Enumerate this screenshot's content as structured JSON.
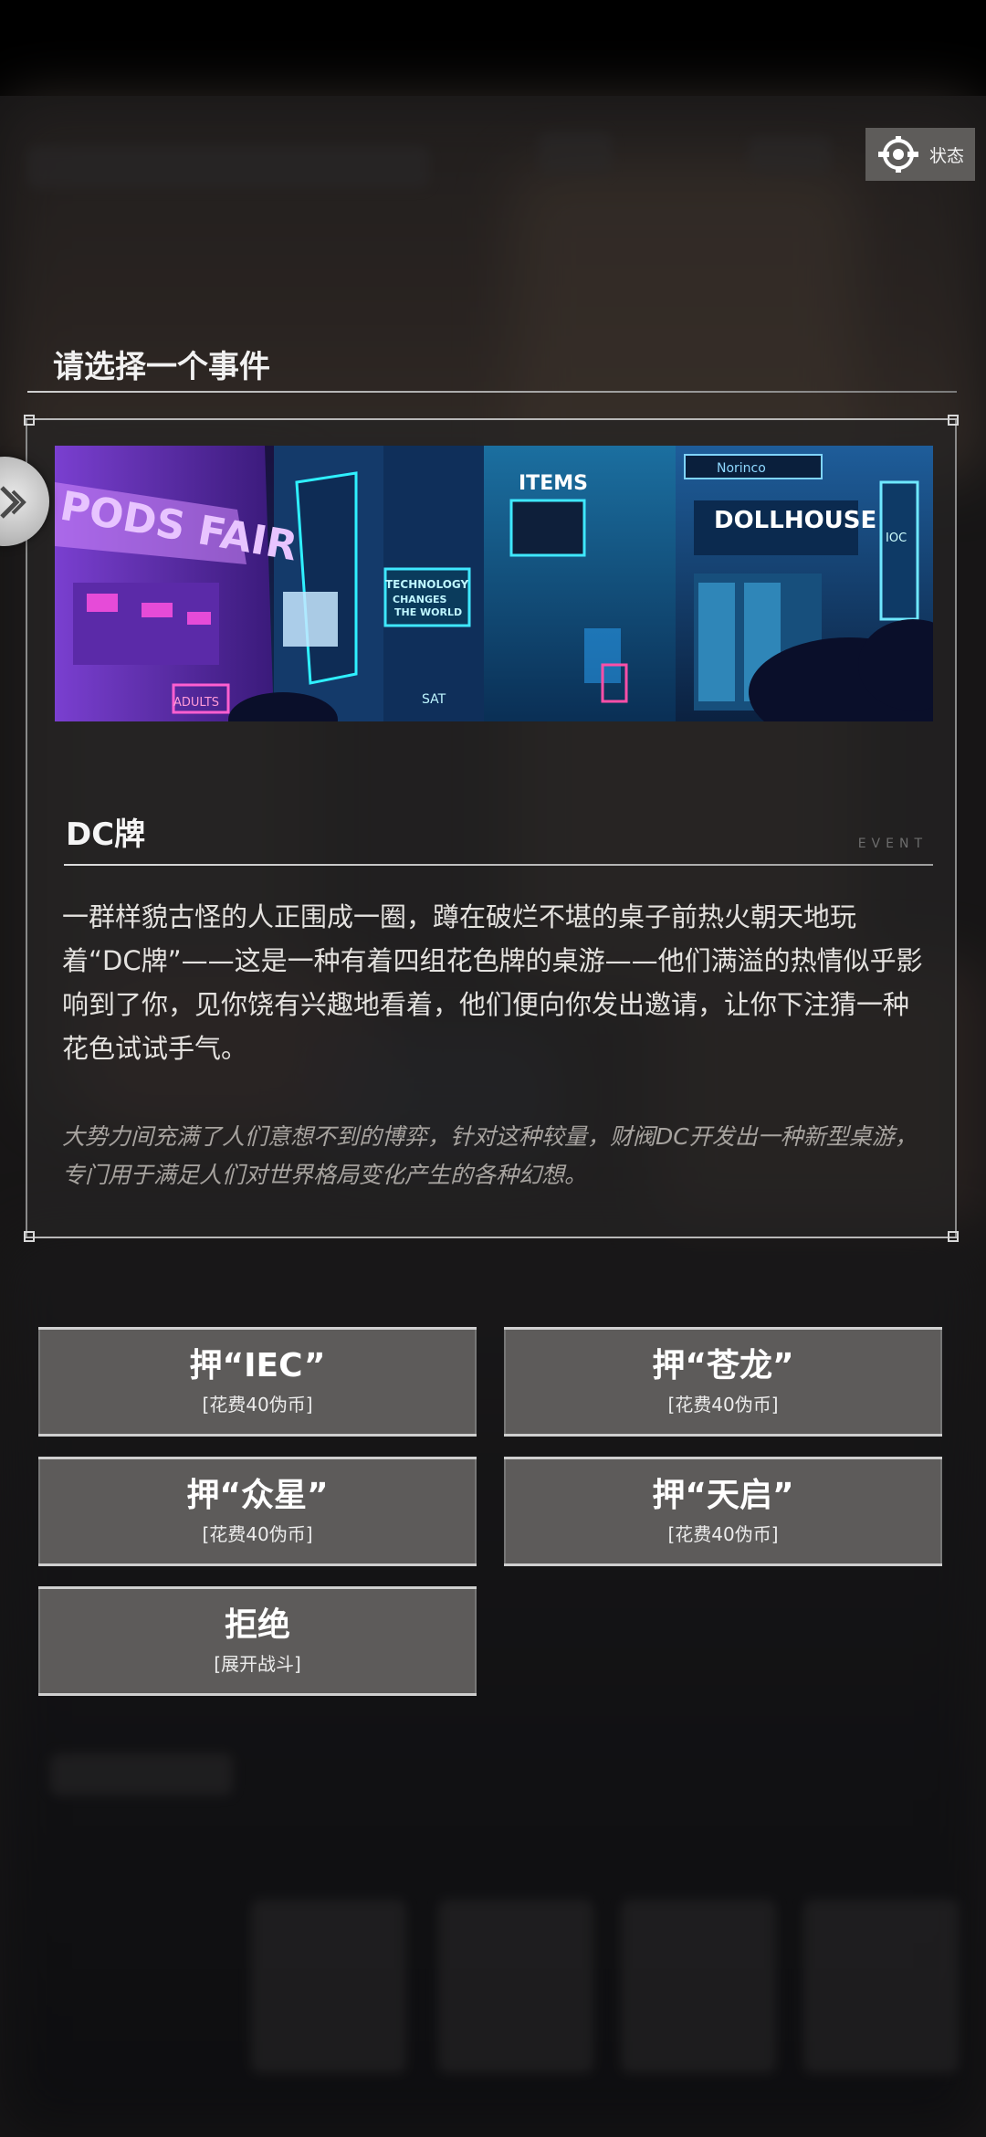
{
  "status_button": {
    "label": "状态",
    "icon": "status-gear-icon"
  },
  "header": {
    "title": "请选择一个事件"
  },
  "event": {
    "name": "DC牌",
    "tag": "EVENT",
    "banner_signs": {
      "left_sign": "PODS FAIR",
      "items": "ITEMS",
      "dollhouse": "DOLLHOUSE",
      "norinco": "Norinco",
      "technology": "TECHNOLOGY",
      "technology2": "CHANGES",
      "technology3": "THE WORLD",
      "ioc": "IOC",
      "adults": "ADULTS",
      "sat": "SAT"
    },
    "description": "一群样貌古怪的人正围成一圈，蹲在破烂不堪的桌子前热火朝天地玩着“DC牌”——这是一种有着四组花色牌的桌游——他们满溢的热情似乎影响到了你，见你饶有兴趣地看着，他们便向你发出邀请，让你下注猜一种花色试试手气。",
    "flavor": "大势力间充满了人们意想不到的博弈，针对这种较量，财阀DC开发出一种新型桌游，专门用于满足人们对世界格局变化产生的各种幻想。"
  },
  "options": [
    {
      "label": "押“IEC”",
      "sub": "[花费40伪币]"
    },
    {
      "label": "押“苍龙”",
      "sub": "[花费40伪币]"
    },
    {
      "label": "押“众星”",
      "sub": "[花费40伪币]"
    },
    {
      "label": "押“天启”",
      "sub": "[花费40伪币]"
    },
    {
      "label": "拒绝",
      "sub": "[展开战斗]"
    }
  ],
  "colors": {
    "button_bg": "#5d5b5a",
    "card_bg": "#262424",
    "text_primary": "#ffffff",
    "text_flavor": "#a7a39f",
    "neon_cyan": "#3fe8ff",
    "neon_purple": "#c04bff"
  }
}
